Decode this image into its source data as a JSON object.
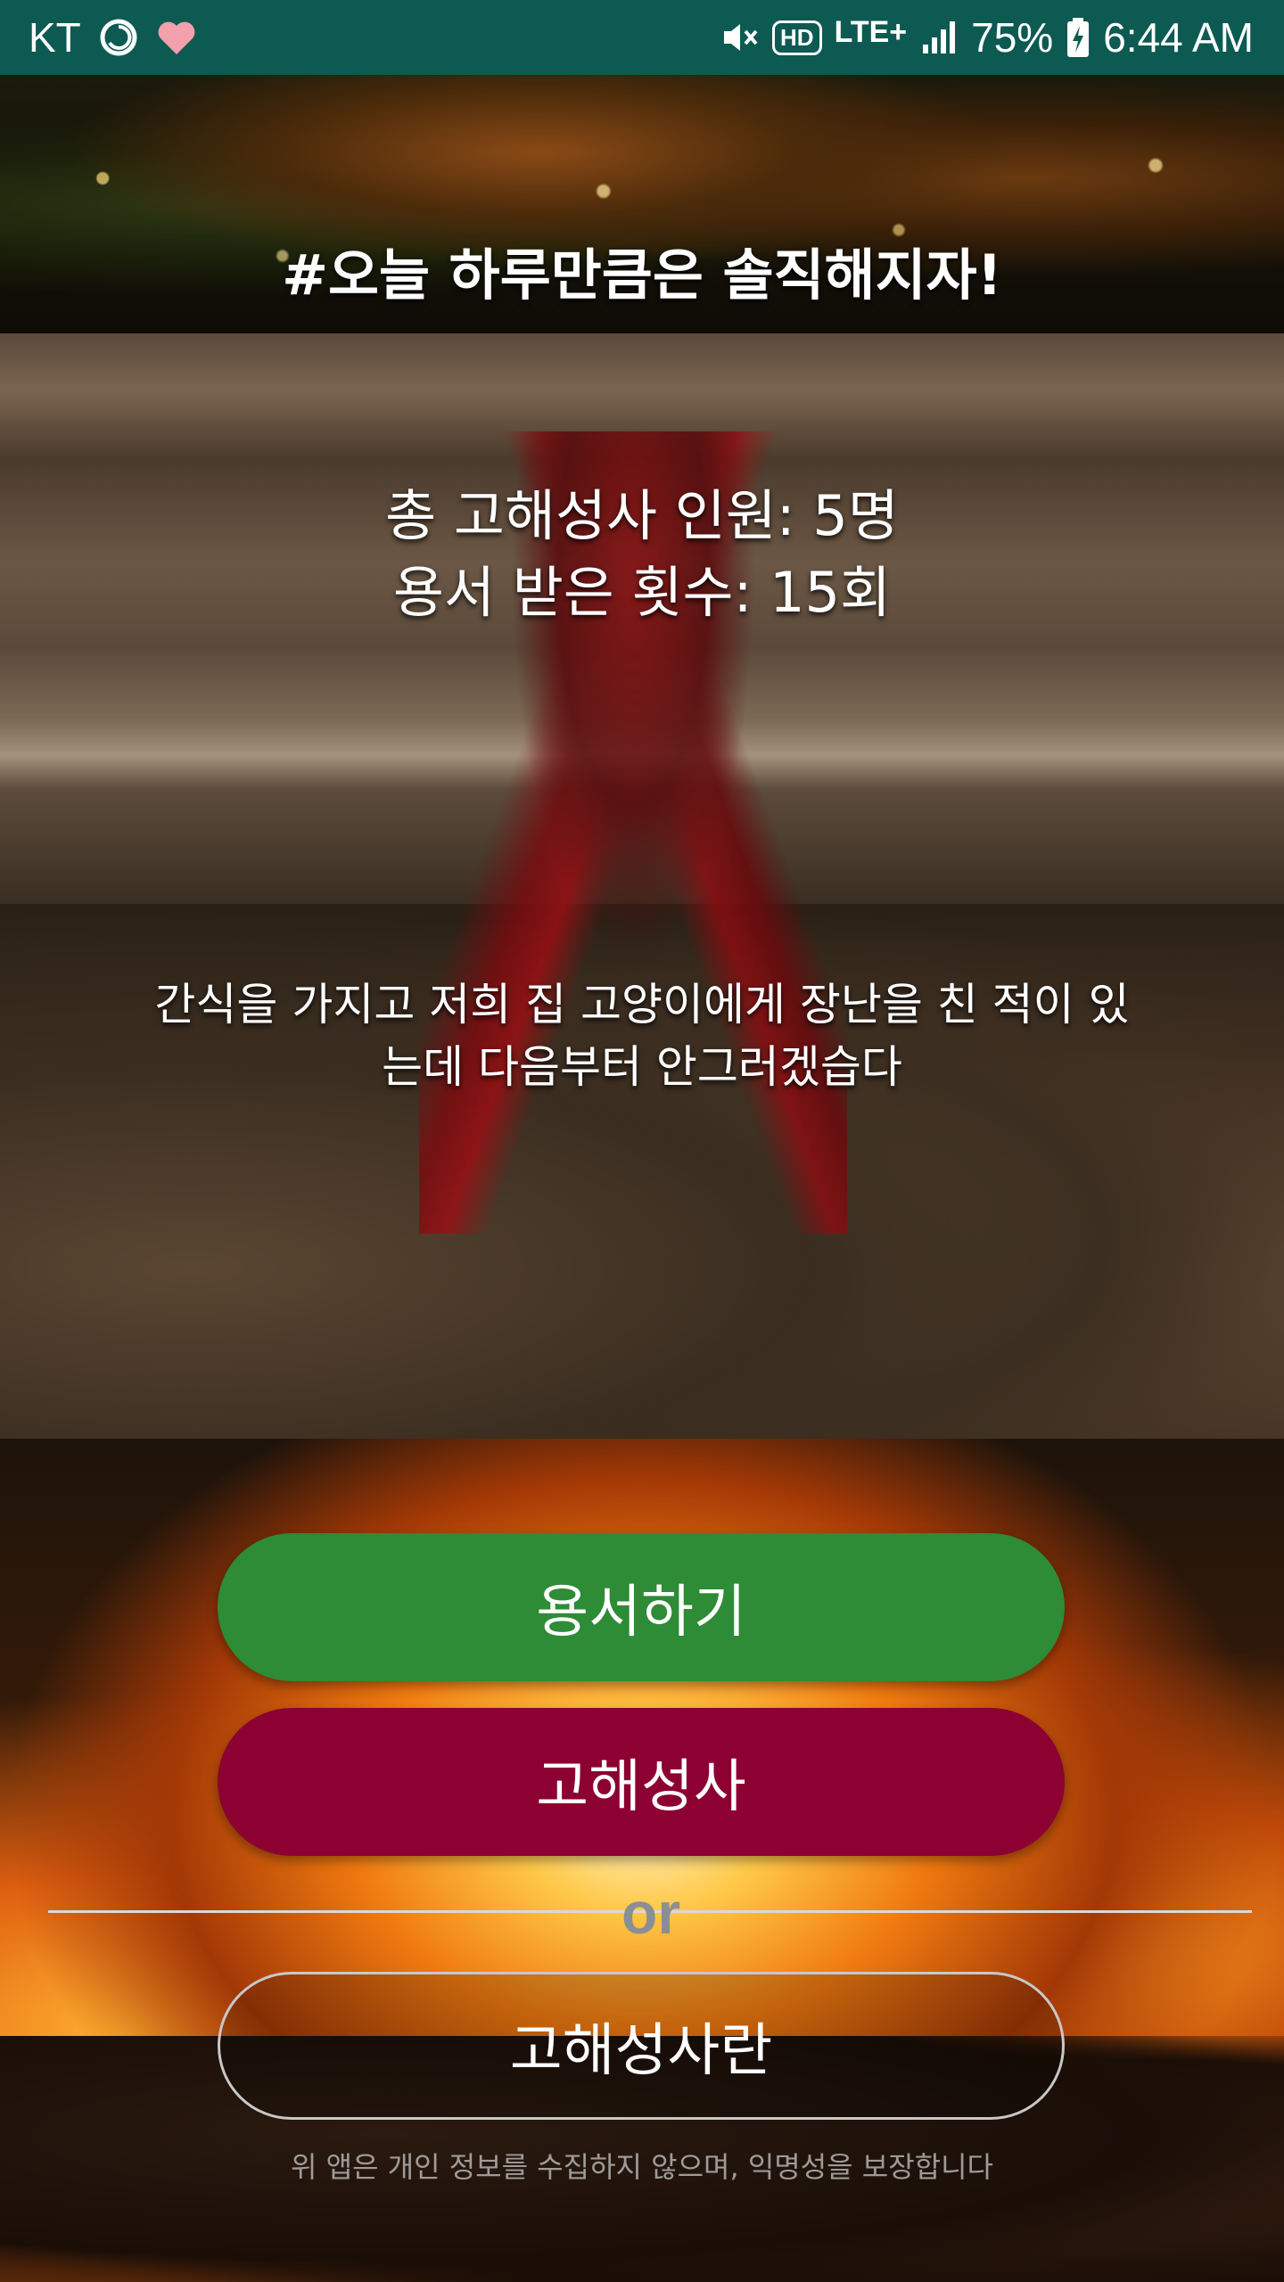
{
  "status_bar": {
    "carrier": "KT",
    "network": "LTE+",
    "hd": "HD",
    "battery": "75%",
    "time": "6:44 AM",
    "icons": [
      "sync-icon",
      "heart-icon",
      "mute-icon",
      "hd-voice-icon",
      "signal-icon",
      "battery-charging-icon"
    ]
  },
  "main": {
    "headline": "#오늘 하루만큼은 솔직해지자!",
    "stats_line1": "총 고해성사 인원: 5명",
    "stats_line2": "용서 받은 횟수: 15회",
    "confession_line1": "간식을 가지고 저희 집 고양이에게 장난을 친 적이 있",
    "confession_line2": "는데 다음부터 안그러겠습다"
  },
  "buttons": {
    "forgive": "용서하기",
    "confess": "고해성사",
    "or": "or",
    "about": "고해성사란"
  },
  "footer": {
    "notice": "위 앱은 개인 정보를 수집하지 않으며, 익명성을 보장합니다"
  },
  "colors": {
    "status_bar": "#0d5a52",
    "forgive_button": "#2e8b36",
    "confess_button": "#8c0032"
  }
}
